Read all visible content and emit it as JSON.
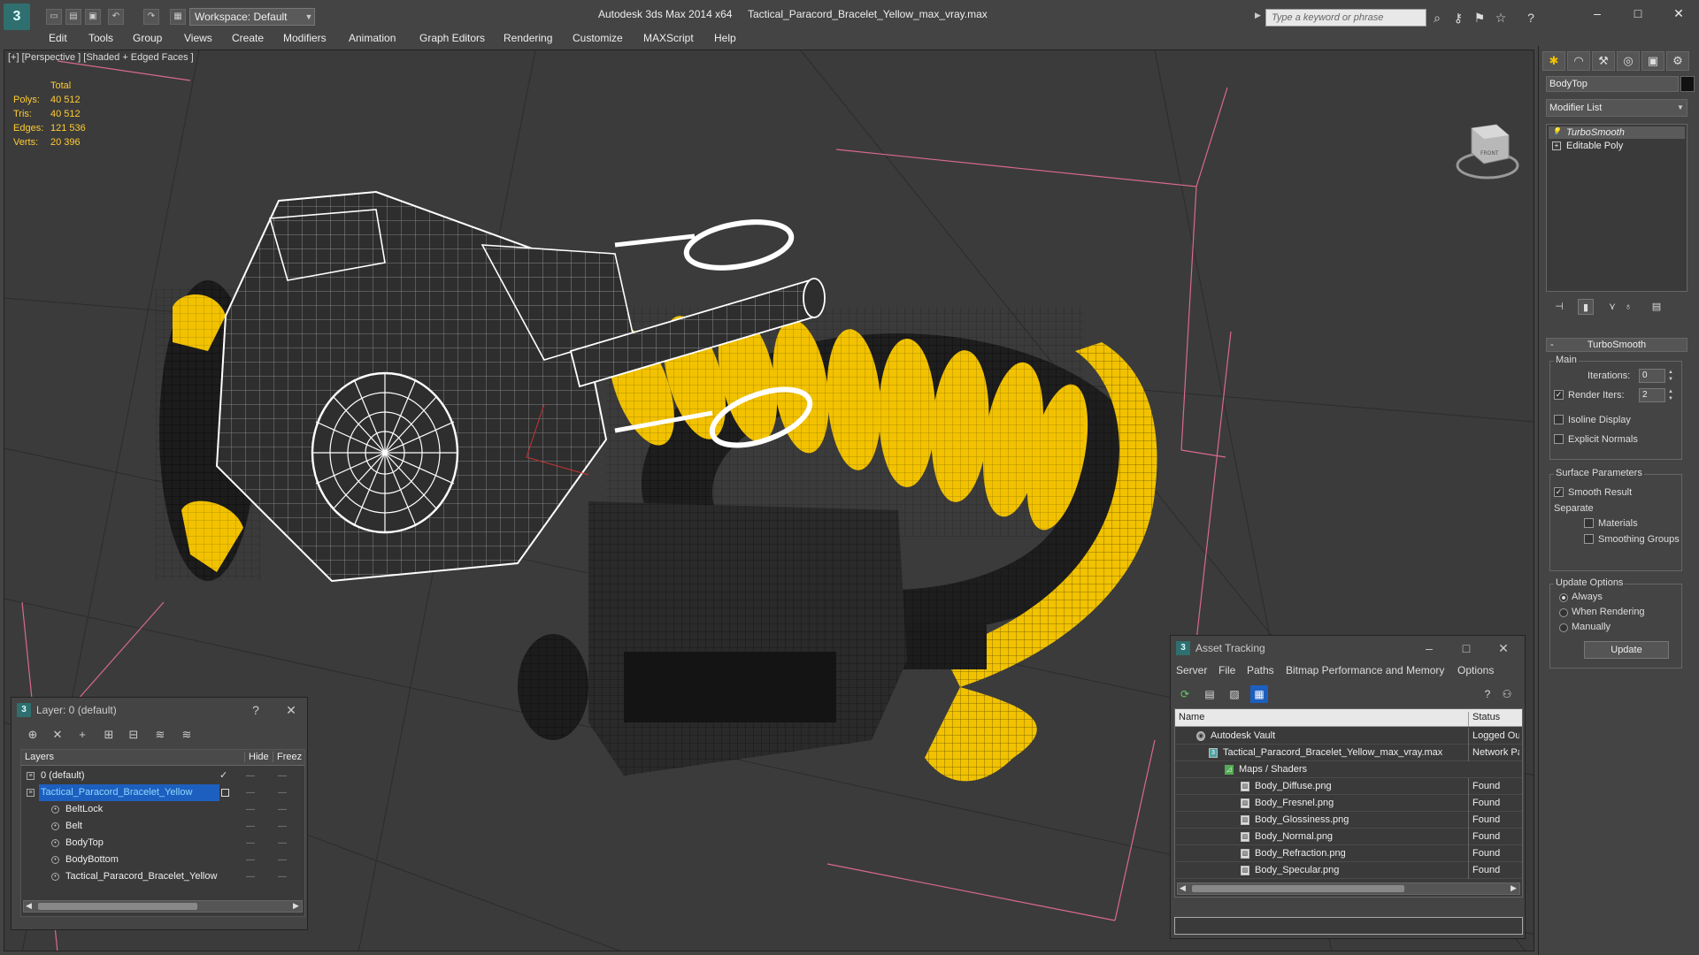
{
  "titlebar": {
    "logo_text": "3",
    "workspace": "Workspace: Default",
    "app_title": "Autodesk 3ds Max  2014 x64",
    "file_title": "Tactical_Paracord_Bracelet_Yellow_max_vray.max",
    "search_placeholder": "Type a keyword or phrase",
    "window_buttons": [
      "–",
      "□",
      "✕"
    ]
  },
  "menu": [
    "Edit",
    "Tools",
    "Group",
    "Views",
    "Create",
    "Modifiers",
    "Animation",
    "Graph Editors",
    "Rendering",
    "Customize",
    "MAXScript",
    "Help"
  ],
  "viewport": {
    "label": "[+] [Perspective ] [Shaded + Edged Faces ]",
    "stats": {
      "header": "Total",
      "rows": [
        {
          "key": "Polys:",
          "value": "40 512"
        },
        {
          "key": "Tris:",
          "value": "40 512"
        },
        {
          "key": "Edges:",
          "value": "121 536"
        },
        {
          "key": "Verts:",
          "value": "20 396"
        }
      ]
    },
    "viewcube_label": "FRONT"
  },
  "command_panel": {
    "tabs": [
      "✱",
      "◠",
      "⚒",
      "◎",
      "▣",
      "⚙"
    ],
    "object_name": "BodyTop",
    "object_color": "#111111",
    "modifier_list": "Modifier List",
    "stack": [
      {
        "icon": "💡",
        "label": "TurboSmooth",
        "italic": true
      },
      {
        "icon": "+",
        "label": "Editable Poly",
        "italic": false
      }
    ],
    "rollout_title": "TurboSmooth",
    "main": {
      "group": "Main",
      "iterations_label": "Iterations:",
      "iterations_value": "0",
      "render_iters_label": "Render Iters:",
      "render_iters_value": "2",
      "isoline_label": "Isoline Display",
      "explicit_label": "Explicit Normals"
    },
    "surface": {
      "group": "Surface Parameters",
      "smooth_label": "Smooth Result",
      "separate_label": "Separate",
      "materials_label": "Materials",
      "smoothing_groups_label": "Smoothing Groups"
    },
    "update": {
      "group": "Update Options",
      "always": "Always",
      "when_rendering": "When Rendering",
      "manually": "Manually",
      "button": "Update"
    }
  },
  "layer_window": {
    "title": "Layer: 0 (default)",
    "help": "?",
    "close": "✕",
    "columns": [
      "Layers",
      "Hide",
      "Freez"
    ],
    "rows": [
      {
        "name": "0 (default)",
        "indent": 0,
        "selected": false,
        "check": "✓"
      },
      {
        "name": "Tactical_Paracord_Bracelet_Yellow",
        "indent": 0,
        "selected": true,
        "check": ""
      },
      {
        "name": "BeltLock",
        "indent": 1,
        "selected": false,
        "check": ""
      },
      {
        "name": "Belt",
        "indent": 1,
        "selected": false,
        "check": ""
      },
      {
        "name": "BodyTop",
        "indent": 1,
        "selected": false,
        "check": ""
      },
      {
        "name": "BodyBottom",
        "indent": 1,
        "selected": false,
        "check": ""
      },
      {
        "name": "Tactical_Paracord_Bracelet_Yellow",
        "indent": 1,
        "selected": false,
        "check": ""
      }
    ]
  },
  "asset_window": {
    "title": "Asset Tracking",
    "menu": [
      "Server",
      "File",
      "Paths",
      "Bitmap Performance and Memory",
      "Options"
    ],
    "columns": [
      "Name",
      "Status"
    ],
    "rows": [
      {
        "name": "Autodesk Vault",
        "status": "Logged Ou",
        "indent": 1
      },
      {
        "name": "Tactical_Paracord_Bracelet_Yellow_max_vray.max",
        "status": "Network Pa",
        "indent": 2
      },
      {
        "name": "Maps / Shaders",
        "status": "",
        "indent": 3
      },
      {
        "name": "Body_Diffuse.png",
        "status": "Found",
        "indent": 4
      },
      {
        "name": "Body_Fresnel.png",
        "status": "Found",
        "indent": 4
      },
      {
        "name": "Body_Glossiness.png",
        "status": "Found",
        "indent": 4
      },
      {
        "name": "Body_Normal.png",
        "status": "Found",
        "indent": 4
      },
      {
        "name": "Body_Refraction.png",
        "status": "Found",
        "indent": 4
      },
      {
        "name": "Body_Specular.png",
        "status": "Found",
        "indent": 4
      }
    ]
  },
  "colors": {
    "accent_yellow": "#f2c200",
    "cord_black": "#1c1c1c",
    "selection_blue": "#1d5fbf",
    "stats_yellow": "#ffcc33"
  }
}
